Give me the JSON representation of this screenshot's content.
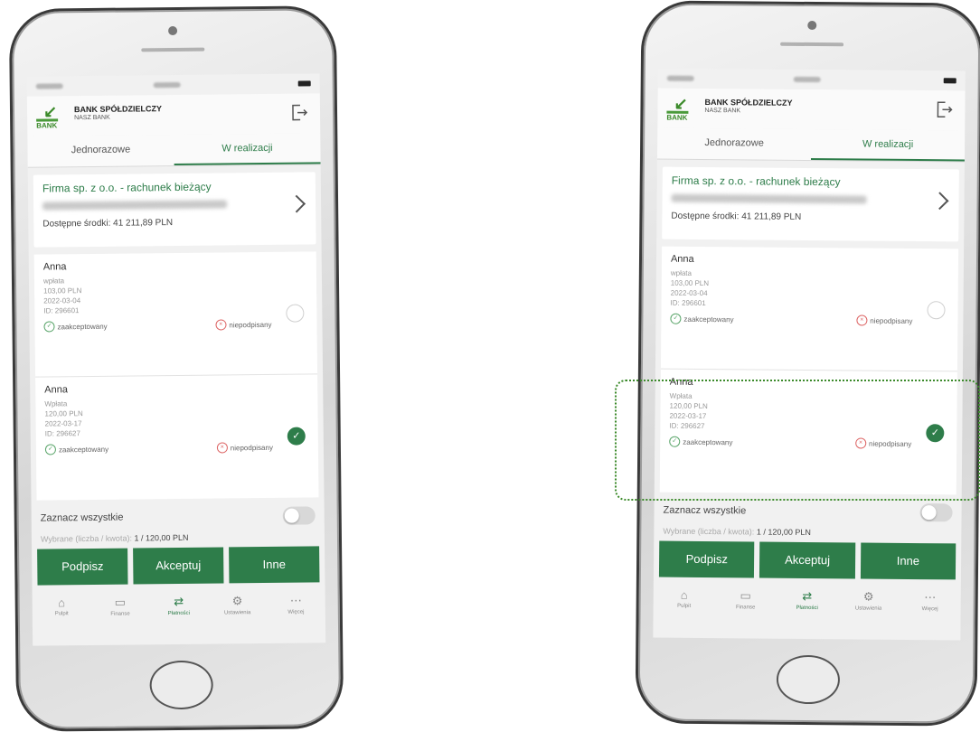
{
  "bank": {
    "logo_text": "BANK",
    "name": "BANK SPÓŁDZIELCZY",
    "subname": "NASZ BANK"
  },
  "tabs": [
    {
      "label": "Jednorazowe"
    },
    {
      "label": "W realizacji"
    }
  ],
  "account": {
    "name": "Firma sp. z o.o. - rachunek bieżący",
    "balance": "Dostępne środki: 41 211,89 PLN"
  },
  "transactions": [
    {
      "name": "Anna",
      "type": "wpłata",
      "amount": "103,00 PLN",
      "date": "2022-03-04",
      "id": "ID: 296601",
      "status_ok": "zaakceptowany",
      "status_no": "niepodpisany",
      "selected": false
    },
    {
      "name": "Anna",
      "type": "Wpłata",
      "amount": "120,00 PLN",
      "date": "2022-03-17",
      "id": "ID: 296627",
      "status_ok": "zaakceptowany",
      "status_no": "niepodpisany",
      "selected": true
    }
  ],
  "select_all": {
    "label": "Zaznacz wszystkie"
  },
  "selected_info": {
    "label": "Wybrane (liczba / kwota):",
    "value": "1 / 120,00 PLN"
  },
  "buttons": {
    "sign": "Podpisz",
    "accept": "Akceptuj",
    "other": "Inne"
  },
  "nav": [
    {
      "label": "Pulpit",
      "icon": "home-icon"
    },
    {
      "label": "Finanse",
      "icon": "wallet-icon"
    },
    {
      "label": "Płatności",
      "icon": "transfer-icon"
    },
    {
      "label": "Ustawienia",
      "icon": "gear-icon"
    },
    {
      "label": "Więcej",
      "icon": "more-icon"
    }
  ],
  "colors": {
    "brand_green": "#2e7d4a",
    "highlight_border": "#3b8a2a"
  }
}
